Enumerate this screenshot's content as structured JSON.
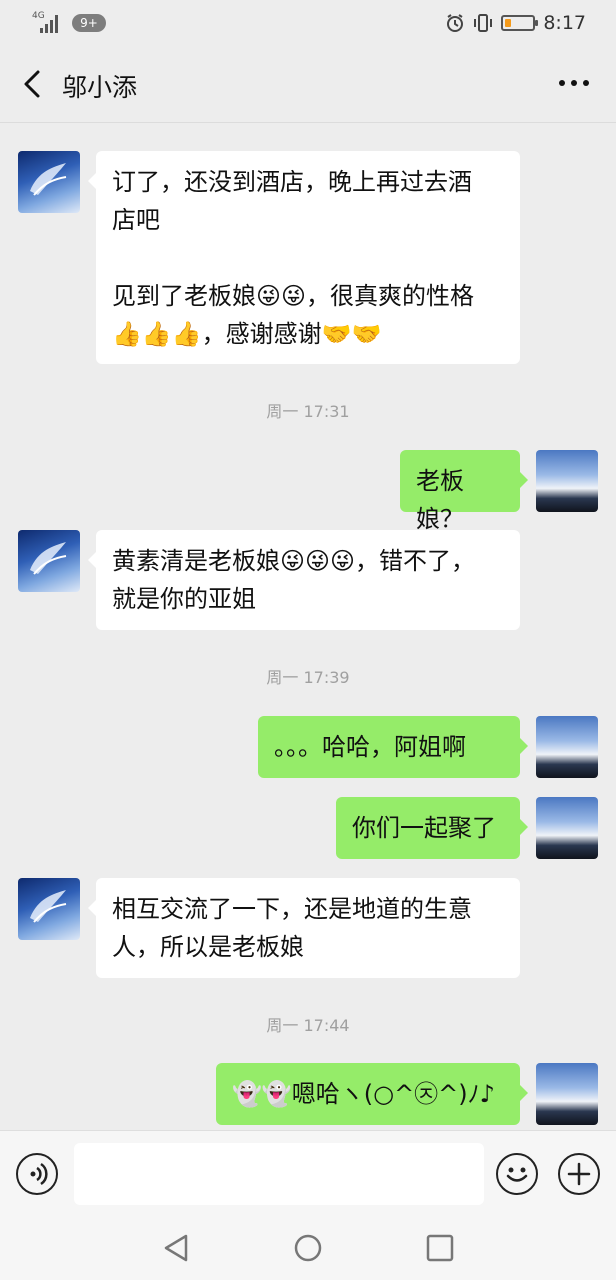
{
  "status_bar": {
    "network": "4G",
    "badge": "9+",
    "time": "8:17",
    "battery_level": 0.2,
    "battery_color": "#f59b1b"
  },
  "header": {
    "title": "邬小添"
  },
  "messages": [
    {
      "side": "left",
      "text": "订了，还没到酒店，晚上再过去酒\n店吧\n\n见到了老板娘😜😜，很真爽的性格\n👍👍👍，感谢感谢🤝🤝"
    },
    {
      "type": "time",
      "text": "周一 17:31"
    },
    {
      "side": "right",
      "text": "老板娘？"
    },
    {
      "side": "left",
      "text": "黄素清是老板娘😜😜😜，错不了，\n就是你的亚姐"
    },
    {
      "type": "time",
      "text": "周一 17:39"
    },
    {
      "side": "right",
      "text": "。。。哈哈，阿姐啊"
    },
    {
      "side": "right",
      "text": "你们一起聚了"
    },
    {
      "side": "left",
      "text": "相互交流了一下，还是地道的生意\n人，所以是老板娘"
    },
    {
      "type": "time",
      "text": "周一 17:44"
    },
    {
      "side": "right",
      "text": "👻👻嗯哈ヽ(○^㉨^)ﾉ♪"
    }
  ],
  "input_bar": {
    "placeholder": "",
    "voice_icon": "voice-icon",
    "emoji_icon": "emoji-icon",
    "plus_icon": "plus-icon"
  },
  "colors": {
    "background": "#ededed",
    "bubble_right": "#95ec69",
    "bubble_left": "#ffffff",
    "time_text": "#a0a0a0"
  }
}
